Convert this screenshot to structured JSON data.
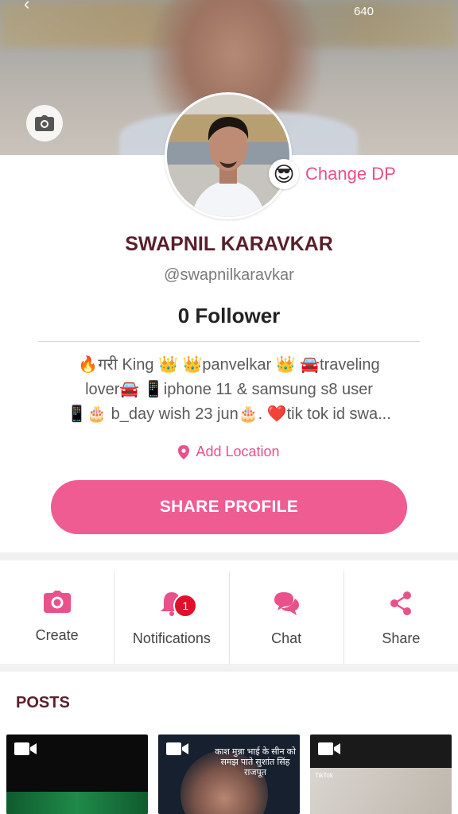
{
  "status": {
    "count": "640"
  },
  "profile": {
    "name": "SWAPNIL KARAVKAR",
    "handle": "@swapnilkaravkar",
    "followers": "0 Follower",
    "change_dp_label": "Change DP",
    "bio_lines": [
      "🔥गरी King 👑     👑panvelkar 👑  🚘traveling",
      "lover🚘 📱iphone 11 & samsung s8 user",
      "📱🎂 b_day wish 23 jun🎂.   ❤️tik tok id swa..."
    ],
    "location_label": "Add Location",
    "share_button": "SHARE PROFILE"
  },
  "actions": [
    {
      "label": "Create",
      "icon": "camera-icon"
    },
    {
      "label": "Notifications",
      "icon": "bell-icon",
      "badge": "1"
    },
    {
      "label": "Chat",
      "icon": "chat-icon"
    },
    {
      "label": "Share",
      "icon": "share-icon"
    }
  ],
  "posts": {
    "title": "POSTS",
    "thumb2_caption": "काश मुन्ना भाई के सीन को समझ पाते सुशांत सिंह राजपूत",
    "thumb3_watermark": "TikTok"
  },
  "colors": {
    "accent": "#ef5c92",
    "name": "#5a1f2c",
    "badge": "#e0102a"
  }
}
